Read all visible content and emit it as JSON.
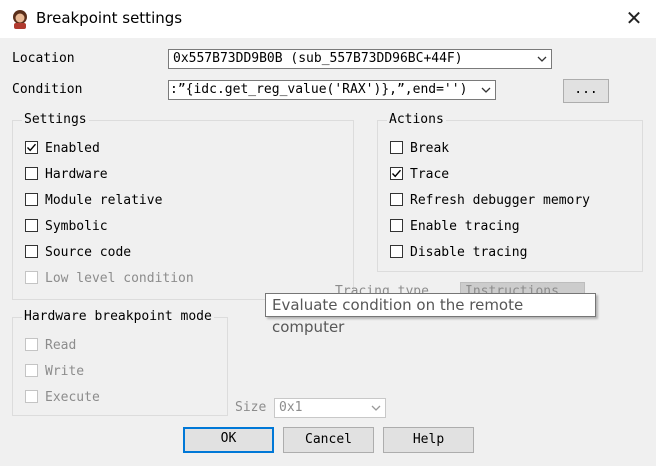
{
  "window": {
    "title": "Breakpoint settings",
    "close_glyph": "✕",
    "app_icon": "ida-icon"
  },
  "location": {
    "label": "Location",
    "value": "0x557B73DD9B0B (sub_557B73DD96BC+44F)"
  },
  "condition": {
    "label": "Condition",
    "value": ":”{idc.get_reg_value('RAX')},”,end='')",
    "browse_label": "..."
  },
  "settings": {
    "title": "Settings",
    "items": [
      {
        "label": "Enabled",
        "checked": true,
        "enabled": true
      },
      {
        "label": "Hardware",
        "checked": false,
        "enabled": true
      },
      {
        "label": "Module relative",
        "checked": false,
        "enabled": true
      },
      {
        "label": "Symbolic",
        "checked": false,
        "enabled": true
      },
      {
        "label": "Source code",
        "checked": false,
        "enabled": true
      },
      {
        "label": "Low level condition",
        "checked": false,
        "enabled": false
      }
    ]
  },
  "actions": {
    "title": "Actions",
    "items": [
      {
        "label": "Break",
        "checked": false
      },
      {
        "label": "Trace",
        "checked": true
      },
      {
        "label": "Refresh debugger memory",
        "checked": false
      },
      {
        "label": "Enable tracing",
        "checked": false
      },
      {
        "label": "Disable tracing",
        "checked": false
      }
    ]
  },
  "tracing_type": {
    "label": "Tracing type",
    "value": "Instructions"
  },
  "tooltip": "Evaluate condition on the remote computer",
  "hw_mode": {
    "title": "Hardware breakpoint mode",
    "items": [
      {
        "label": "Read",
        "checked": false
      },
      {
        "label": "Write",
        "checked": false
      },
      {
        "label": "Execute",
        "checked": false
      }
    ]
  },
  "size": {
    "label": "Size",
    "value": "0x1"
  },
  "buttons": {
    "ok": "OK",
    "cancel": "Cancel",
    "help": "Help"
  }
}
